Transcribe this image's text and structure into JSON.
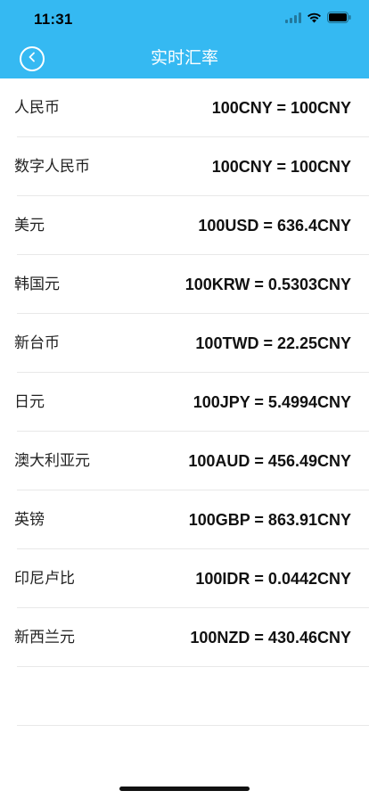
{
  "status_bar": {
    "time": "11:31"
  },
  "nav": {
    "title": "实时汇率"
  },
  "rates": [
    {
      "name": "人民币",
      "rate": "100CNY = 100CNY"
    },
    {
      "name": "数字人民币",
      "rate": "100CNY = 100CNY"
    },
    {
      "name": "美元",
      "rate": "100USD = 636.4CNY"
    },
    {
      "name": "韩国元",
      "rate": "100KRW = 0.5303CNY"
    },
    {
      "name": "新台币",
      "rate": "100TWD = 22.25CNY"
    },
    {
      "name": "日元",
      "rate": "100JPY = 5.4994CNY"
    },
    {
      "name": "澳大利亚元",
      "rate": "100AUD = 456.49CNY"
    },
    {
      "name": "英镑",
      "rate": "100GBP = 863.91CNY"
    },
    {
      "name": "印尼卢比",
      "rate": "100IDR = 0.0442CNY"
    },
    {
      "name": "新西兰元",
      "rate": "100NZD = 430.46CNY"
    }
  ],
  "colors": {
    "header": "#35b9f2"
  }
}
